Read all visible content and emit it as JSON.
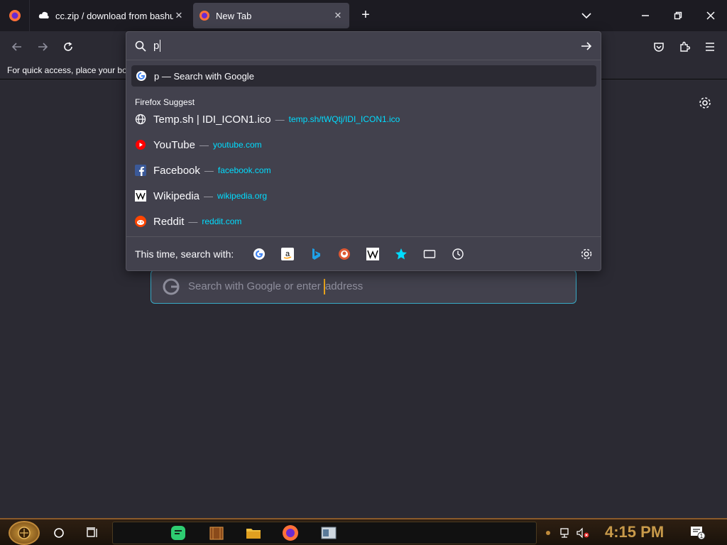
{
  "tabs": [
    {
      "title": "cc.zip / download from bashupload",
      "icon": "cloud-icon"
    },
    {
      "title": "New Tab",
      "icon": "firefox-icon"
    }
  ],
  "bookmarks_hint": "For quick access, place your bookmarks here on the bookmarks toolbar.",
  "urlbar": {
    "value": "p"
  },
  "suggestions": {
    "search_row": {
      "query": "p",
      "text": "— Search with Google"
    },
    "group_label": "Firefox Suggest",
    "items": [
      {
        "title": "Temp.sh | IDI_ICON1.ico",
        "url": "temp.sh/tWQtj/IDI_ICON1.ico",
        "icon": "globe-icon"
      },
      {
        "title": "YouTube",
        "url": "youtube.com",
        "icon": "youtube-icon"
      },
      {
        "title": "Facebook",
        "url": "facebook.com",
        "icon": "facebook-icon"
      },
      {
        "title": "Wikipedia",
        "url": "wikipedia.org",
        "icon": "wikipedia-icon"
      },
      {
        "title": "Reddit",
        "url": "reddit.com",
        "icon": "reddit-icon"
      }
    ],
    "separator": "—"
  },
  "oneoff": {
    "label": "This time, search with:"
  },
  "newtab_search": {
    "placeholder_a": "Search with Google or enter ",
    "placeholder_b": "address"
  },
  "clock": "4:15 PM",
  "notification_count": "1",
  "colors": {
    "accent": "#00ddff",
    "focus_border": "#38a9c5",
    "clock": "#c89a4a"
  }
}
